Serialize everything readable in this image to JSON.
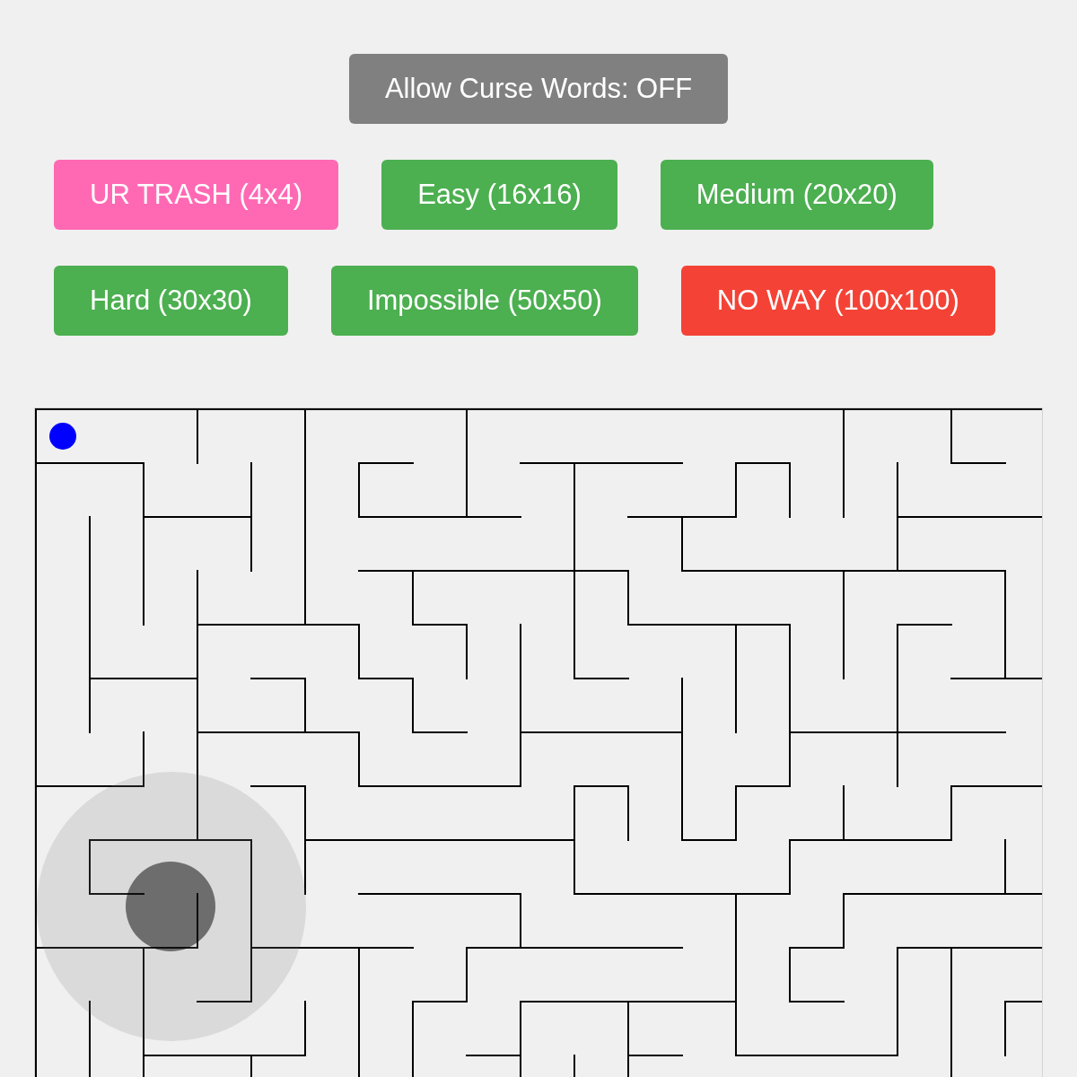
{
  "curse_words_toggle": {
    "label": "Allow Curse Words: OFF"
  },
  "difficulty_buttons": [
    {
      "label": "UR TRASH (4x4)",
      "color": "#ff69b4"
    },
    {
      "label": "Easy (16x16)",
      "color": "#4caf50"
    },
    {
      "label": "Medium (20x20)",
      "color": "#4caf50"
    },
    {
      "label": "Hard (30x30)",
      "color": "#4caf50"
    },
    {
      "label": "Impossible (50x50)",
      "color": "#4caf50"
    },
    {
      "label": "NO WAY (100x100)",
      "color": "#f44336"
    }
  ]
}
